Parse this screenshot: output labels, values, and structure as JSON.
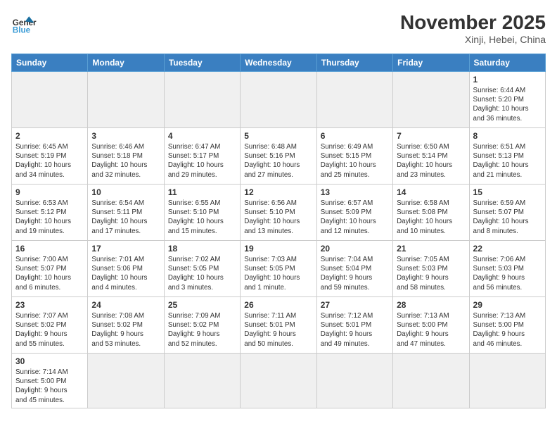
{
  "header": {
    "logo": {
      "general": "General",
      "blue": "Blue"
    },
    "month": "November 2025",
    "location": "Xinji, Hebei, China"
  },
  "weekdays": [
    "Sunday",
    "Monday",
    "Tuesday",
    "Wednesday",
    "Thursday",
    "Friday",
    "Saturday"
  ],
  "weeks": [
    [
      {
        "day": null,
        "info": null
      },
      {
        "day": null,
        "info": null
      },
      {
        "day": null,
        "info": null
      },
      {
        "day": null,
        "info": null
      },
      {
        "day": null,
        "info": null
      },
      {
        "day": null,
        "info": null
      },
      {
        "day": "1",
        "info": "Sunrise: 6:44 AM\nSunset: 5:20 PM\nDaylight: 10 hours\nand 36 minutes."
      }
    ],
    [
      {
        "day": "2",
        "info": "Sunrise: 6:45 AM\nSunset: 5:19 PM\nDaylight: 10 hours\nand 34 minutes."
      },
      {
        "day": "3",
        "info": "Sunrise: 6:46 AM\nSunset: 5:18 PM\nDaylight: 10 hours\nand 32 minutes."
      },
      {
        "day": "4",
        "info": "Sunrise: 6:47 AM\nSunset: 5:17 PM\nDaylight: 10 hours\nand 29 minutes."
      },
      {
        "day": "5",
        "info": "Sunrise: 6:48 AM\nSunset: 5:16 PM\nDaylight: 10 hours\nand 27 minutes."
      },
      {
        "day": "6",
        "info": "Sunrise: 6:49 AM\nSunset: 5:15 PM\nDaylight: 10 hours\nand 25 minutes."
      },
      {
        "day": "7",
        "info": "Sunrise: 6:50 AM\nSunset: 5:14 PM\nDaylight: 10 hours\nand 23 minutes."
      },
      {
        "day": "8",
        "info": "Sunrise: 6:51 AM\nSunset: 5:13 PM\nDaylight: 10 hours\nand 21 minutes."
      }
    ],
    [
      {
        "day": "9",
        "info": "Sunrise: 6:53 AM\nSunset: 5:12 PM\nDaylight: 10 hours\nand 19 minutes."
      },
      {
        "day": "10",
        "info": "Sunrise: 6:54 AM\nSunset: 5:11 PM\nDaylight: 10 hours\nand 17 minutes."
      },
      {
        "day": "11",
        "info": "Sunrise: 6:55 AM\nSunset: 5:10 PM\nDaylight: 10 hours\nand 15 minutes."
      },
      {
        "day": "12",
        "info": "Sunrise: 6:56 AM\nSunset: 5:10 PM\nDaylight: 10 hours\nand 13 minutes."
      },
      {
        "day": "13",
        "info": "Sunrise: 6:57 AM\nSunset: 5:09 PM\nDaylight: 10 hours\nand 12 minutes."
      },
      {
        "day": "14",
        "info": "Sunrise: 6:58 AM\nSunset: 5:08 PM\nDaylight: 10 hours\nand 10 minutes."
      },
      {
        "day": "15",
        "info": "Sunrise: 6:59 AM\nSunset: 5:07 PM\nDaylight: 10 hours\nand 8 minutes."
      }
    ],
    [
      {
        "day": "16",
        "info": "Sunrise: 7:00 AM\nSunset: 5:07 PM\nDaylight: 10 hours\nand 6 minutes."
      },
      {
        "day": "17",
        "info": "Sunrise: 7:01 AM\nSunset: 5:06 PM\nDaylight: 10 hours\nand 4 minutes."
      },
      {
        "day": "18",
        "info": "Sunrise: 7:02 AM\nSunset: 5:05 PM\nDaylight: 10 hours\nand 3 minutes."
      },
      {
        "day": "19",
        "info": "Sunrise: 7:03 AM\nSunset: 5:05 PM\nDaylight: 10 hours\nand 1 minute."
      },
      {
        "day": "20",
        "info": "Sunrise: 7:04 AM\nSunset: 5:04 PM\nDaylight: 9 hours\nand 59 minutes."
      },
      {
        "day": "21",
        "info": "Sunrise: 7:05 AM\nSunset: 5:03 PM\nDaylight: 9 hours\nand 58 minutes."
      },
      {
        "day": "22",
        "info": "Sunrise: 7:06 AM\nSunset: 5:03 PM\nDaylight: 9 hours\nand 56 minutes."
      }
    ],
    [
      {
        "day": "23",
        "info": "Sunrise: 7:07 AM\nSunset: 5:02 PM\nDaylight: 9 hours\nand 55 minutes."
      },
      {
        "day": "24",
        "info": "Sunrise: 7:08 AM\nSunset: 5:02 PM\nDaylight: 9 hours\nand 53 minutes."
      },
      {
        "day": "25",
        "info": "Sunrise: 7:09 AM\nSunset: 5:02 PM\nDaylight: 9 hours\nand 52 minutes."
      },
      {
        "day": "26",
        "info": "Sunrise: 7:11 AM\nSunset: 5:01 PM\nDaylight: 9 hours\nand 50 minutes."
      },
      {
        "day": "27",
        "info": "Sunrise: 7:12 AM\nSunset: 5:01 PM\nDaylight: 9 hours\nand 49 minutes."
      },
      {
        "day": "28",
        "info": "Sunrise: 7:13 AM\nSunset: 5:00 PM\nDaylight: 9 hours\nand 47 minutes."
      },
      {
        "day": "29",
        "info": "Sunrise: 7:13 AM\nSunset: 5:00 PM\nDaylight: 9 hours\nand 46 minutes."
      }
    ],
    [
      {
        "day": "30",
        "info": "Sunrise: 7:14 AM\nSunset: 5:00 PM\nDaylight: 9 hours\nand 45 minutes."
      },
      {
        "day": null,
        "info": null
      },
      {
        "day": null,
        "info": null
      },
      {
        "day": null,
        "info": null
      },
      {
        "day": null,
        "info": null
      },
      {
        "day": null,
        "info": null
      },
      {
        "day": null,
        "info": null
      }
    ]
  ]
}
